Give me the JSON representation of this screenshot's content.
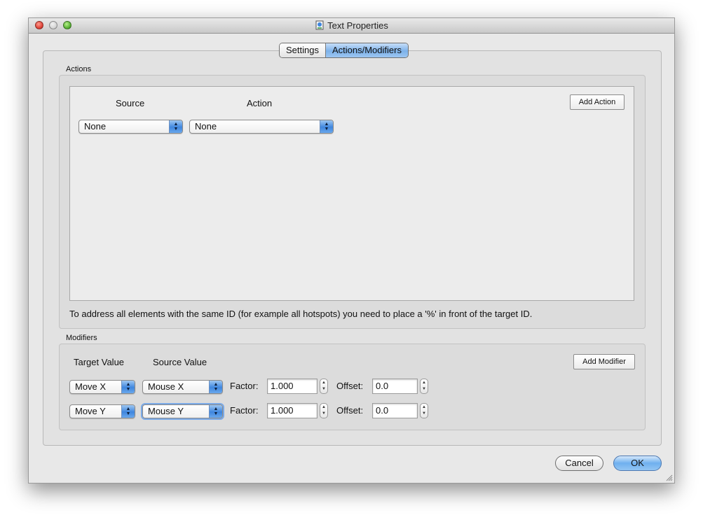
{
  "window": {
    "title": "Text Properties"
  },
  "tabs": [
    {
      "label": "Settings",
      "selected": false
    },
    {
      "label": "Actions/Modifiers",
      "selected": true
    }
  ],
  "actions": {
    "group_label": "Actions",
    "source_header": "Source",
    "action_header": "Action",
    "rows": [
      {
        "source": "None",
        "action": "None"
      }
    ],
    "add_button": "Add Action",
    "note": "To address all elements with the same ID (for example all hotspots) you need to place a '%' in front of the target ID."
  },
  "modifiers": {
    "group_label": "Modifiers",
    "target_header": "Target Value",
    "source_header": "Source Value",
    "add_button": "Add Modifier",
    "factor_label": "Factor:",
    "offset_label": "Offset:",
    "rows": [
      {
        "target": "Move X",
        "source": "Mouse X",
        "factor": "1.000",
        "offset": "0.0"
      },
      {
        "target": "Move Y",
        "source": "Mouse Y",
        "factor": "1.000",
        "offset": "0.0"
      }
    ]
  },
  "buttons": {
    "cancel": "Cancel",
    "ok": "OK"
  },
  "colors": {
    "accent": "#6fb0ef",
    "window_bg": "#e8e8e8"
  }
}
